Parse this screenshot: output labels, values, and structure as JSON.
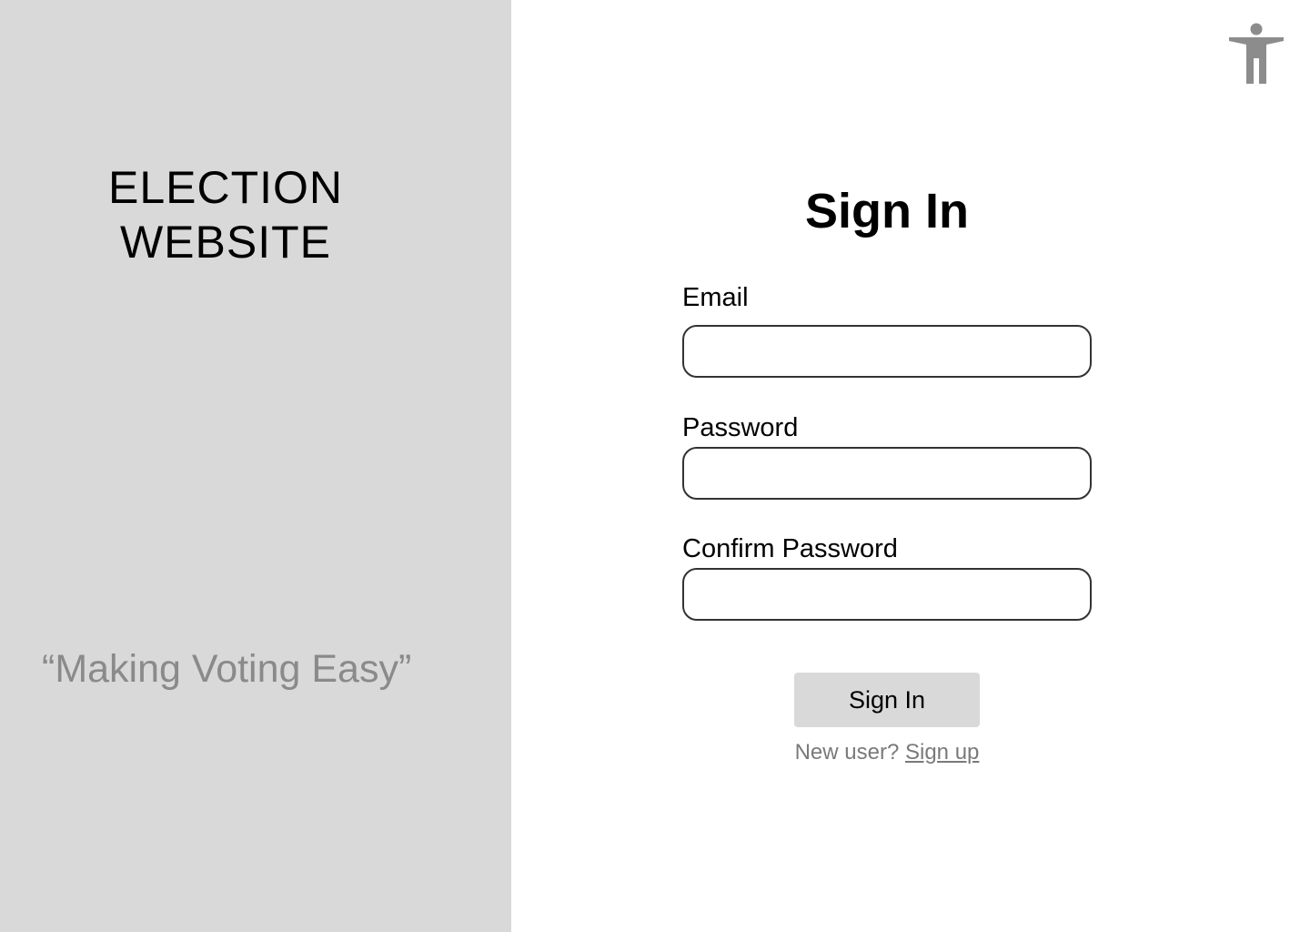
{
  "brand": {
    "title_line1": "ELECTION",
    "title_line2": "WEBSITE",
    "tagline": "“Making Voting Easy”"
  },
  "accessibility": {
    "icon": "accessibility-icon"
  },
  "form": {
    "title": "Sign In",
    "email_label": "Email",
    "email_value": "",
    "password_label": "Password",
    "password_value": "",
    "confirm_password_label": "Confirm Password",
    "confirm_password_value": "",
    "submit_label": "Sign In",
    "new_user_text": "New user?",
    "signup_link": "Sign up"
  },
  "colors": {
    "left_panel_bg": "#d9d9d9",
    "button_bg": "#d9d9d9",
    "muted_text": "#7a7a7a",
    "icon_gray": "#8c8c8c",
    "input_border": "#333333"
  }
}
